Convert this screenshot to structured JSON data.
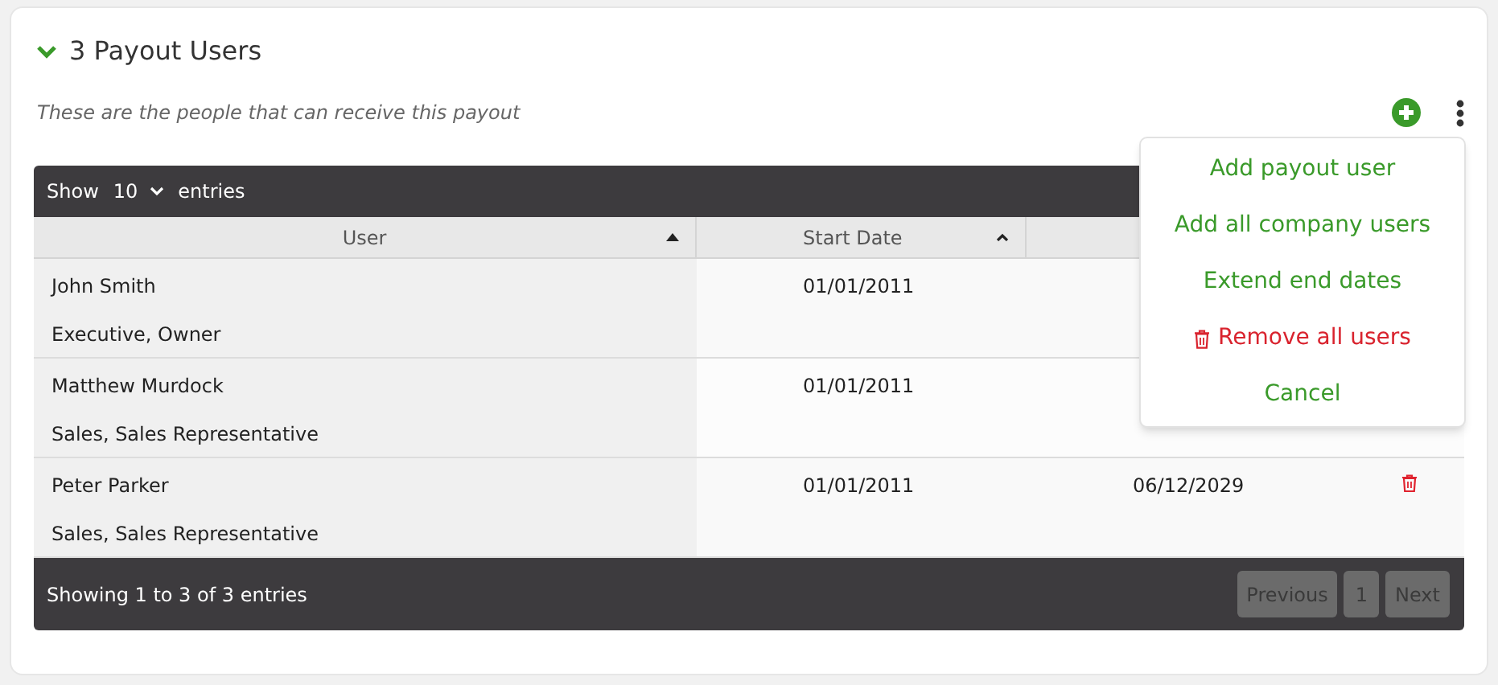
{
  "section": {
    "title": "3 Payout Users",
    "expanded": true,
    "subtitle": "These are the people that can receive this payout"
  },
  "table": {
    "length_label_before": "Show",
    "length_value": "10",
    "length_label_after": "entries",
    "columns": [
      "User",
      "Start Date"
    ],
    "rows": [
      {
        "name": "John Smith",
        "role": "Executive, Owner",
        "start": "01/01/2011",
        "delete": false
      },
      {
        "name": "Matthew Murdock",
        "role": "Sales, Sales Representative",
        "start": "01/01/2011",
        "delete": false
      },
      {
        "name": "Peter Parker",
        "role": "Sales, Sales Representative",
        "start": "01/01/2011",
        "end": "06/12/2029",
        "delete": true
      }
    ],
    "info": "Showing 1 to 3 of 3 entries",
    "pagination": [
      {
        "label": "Previous",
        "kind": "prev"
      },
      {
        "label": "1",
        "kind": "page"
      },
      {
        "label": "Next",
        "kind": "next"
      }
    ]
  },
  "menu": [
    {
      "label": "Add payout user",
      "kind": "normal"
    },
    {
      "label": "Add all company users",
      "kind": "normal"
    },
    {
      "label": "Extend end dates",
      "kind": "normal"
    },
    {
      "label": "Remove all users",
      "kind": "danger"
    },
    {
      "label": "Cancel",
      "kind": "normal"
    }
  ]
}
